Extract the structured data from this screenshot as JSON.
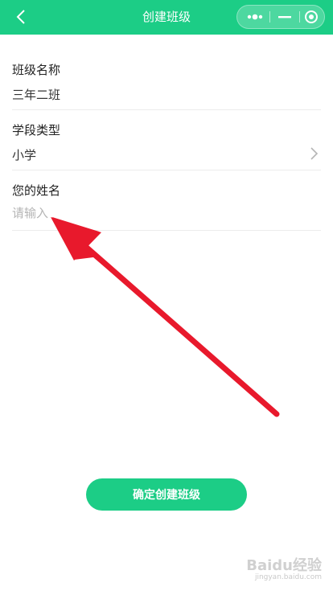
{
  "header": {
    "title": "创建班级",
    "background_color": "#1ccd86"
  },
  "icons": {
    "back": "chevron-left-icon",
    "more": "more-dots-icon",
    "minimize": "minimize-icon",
    "close": "target-close-icon",
    "select": "chevron-right-icon"
  },
  "form": {
    "class_name": {
      "label": "班级名称",
      "value": "三年二班"
    },
    "stage_type": {
      "label": "学段类型",
      "value": "小学"
    },
    "your_name": {
      "label": "您的姓名",
      "placeholder": "请输入",
      "value": ""
    }
  },
  "submit": {
    "label": "确定创建班级"
  },
  "annotation": {
    "color": "#e8192c"
  },
  "watermark": {
    "logo": "Baidu经验",
    "url": "jingyan.baidu.com"
  }
}
